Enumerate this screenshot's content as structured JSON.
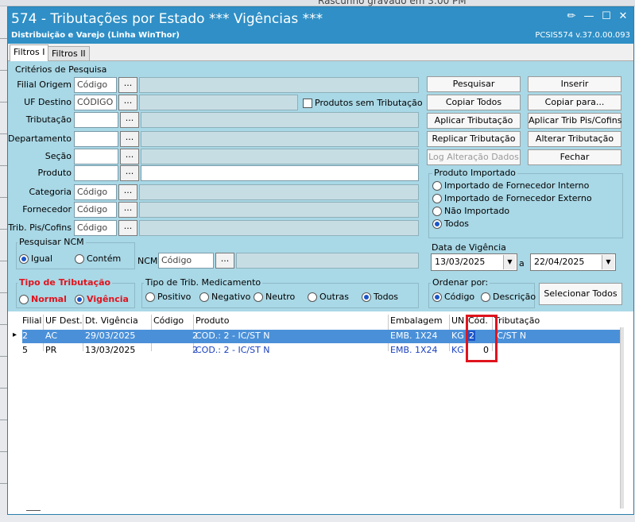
{
  "background": {
    "bar_text": "Rascunho gravado em 3:00 PM"
  },
  "window": {
    "title": "574 - Tributações por Estado *** Vigências ***",
    "subtitle": "Distribuição e Varejo (Linha WinThor)",
    "version": "PCSIS574  v.37.0.00.093",
    "controls": [
      "edit-icon",
      "minimize-icon",
      "maximize-icon",
      "close-icon"
    ]
  },
  "tabs": [
    {
      "label": "Filtros I",
      "active": true
    },
    {
      "label": "Filtros II",
      "active": false
    }
  ],
  "criteria": {
    "section_title": "Critérios de Pesquisa",
    "filial_origem": {
      "label": "Filial Origem",
      "placeholder": "Código"
    },
    "uf_destino": {
      "label": "UF Destino",
      "placeholder": "CÓDIGO"
    },
    "tributacao": {
      "label": "Tributação"
    },
    "departamento": {
      "label": "Departamento"
    },
    "secao": {
      "label": "Seção"
    },
    "produto": {
      "label": "Produto"
    },
    "categoria": {
      "label": "Categoria",
      "placeholder": "Código"
    },
    "fornecedor": {
      "label": "Fornecedor",
      "placeholder": "Código"
    },
    "trib_pis_cofins": {
      "label": "Trib. Pis/Cofins",
      "placeholder": "Código"
    },
    "produtos_sem_tributacao": "Produtos sem Tributação",
    "ellipsis": "..."
  },
  "buttons": {
    "pesquisar": "Pesquisar",
    "inserir": "Inserir",
    "copiar_todos": "Copiar Todos",
    "copiar_para": "Copiar para...",
    "aplicar_tributacao": "Aplicar Tributação",
    "aplicar_trib_pis": "Aplicar Trib Pis/Cofins",
    "replicar_tributacao": "Replicar Tributação",
    "alterar_tributacao": "Alterar Tributação",
    "log_alteracao": "Log Alteração Dados",
    "fechar": "Fechar",
    "selecionar_todos": "Selecionar Todos"
  },
  "produto_importado": {
    "title": "Produto Importado",
    "options": [
      {
        "label": "Importado de Fornecedor Interno",
        "selected": false
      },
      {
        "label": "Importado de Fornecedor Externo",
        "selected": false
      },
      {
        "label": "Não Importado",
        "selected": false
      },
      {
        "label": "Todos",
        "selected": true
      }
    ]
  },
  "pesquisar_ncm": {
    "title": "Pesquisar NCM",
    "options": [
      {
        "label": "Igual",
        "selected": true
      },
      {
        "label": "Contém",
        "selected": false
      }
    ],
    "ncm_label": "NCM",
    "ncm_placeholder": "Código"
  },
  "data_vigencia": {
    "title": "Data de Vigência",
    "from": "13/03/2025",
    "sep": "a",
    "to": "22/04/2025"
  },
  "tipo_tributacao": {
    "title": "Tipo de Tributação",
    "options": [
      {
        "label": "Normal",
        "selected": false
      },
      {
        "label": "Vigência",
        "selected": true
      }
    ]
  },
  "tipo_trib_medicamento": {
    "title": "Tipo de Trib. Medicamento",
    "options": [
      {
        "label": "Positivo",
        "selected": false
      },
      {
        "label": "Negativo",
        "selected": false
      },
      {
        "label": "Neutro",
        "selected": false
      },
      {
        "label": "Outras",
        "selected": false
      },
      {
        "label": "Todos",
        "selected": true
      }
    ]
  },
  "ordenar_por": {
    "title": "Ordenar por:",
    "options": [
      {
        "label": "Código",
        "selected": true
      },
      {
        "label": "Descrição",
        "selected": false
      }
    ]
  },
  "grid": {
    "columns": [
      "Filial",
      "UF Dest.",
      "Dt. Vigência",
      "Código",
      "Produto",
      "Embalagem",
      "UN",
      "Cód.",
      "Tributação"
    ],
    "rows": [
      {
        "filial": "2",
        "uf": "AC",
        "dt": "29/03/2025",
        "codigo": "2",
        "produto": "COD.: 2 - IC/ST N",
        "embalagem": "EMB. 1X24",
        "un": "KG",
        "cod": "2",
        "tributacao": "IC/ST N",
        "selected": true
      },
      {
        "filial": "5",
        "uf": "PR",
        "dt": "13/03/2025",
        "codigo": "2",
        "produto": "COD.: 2 - IC/ST N",
        "embalagem": "EMB. 1X24",
        "un": "KG",
        "cod": "0",
        "tributacao": "",
        "selected": false
      }
    ],
    "row_indicator": "▸"
  },
  "colors": {
    "title_bar": "#2f8fc6",
    "panel": "#a9d8e6",
    "selected_row": "#4a90d9",
    "highlight_box": "#e0141e",
    "tipo_title": "#e0141e"
  }
}
